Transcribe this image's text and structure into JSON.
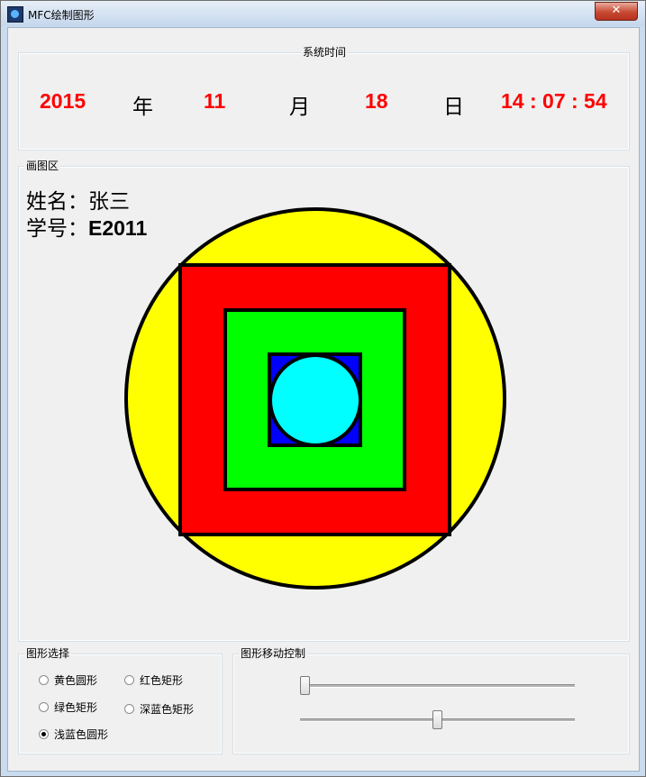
{
  "window": {
    "title": "MFC绘制图形",
    "close_label": "✕"
  },
  "time_group": {
    "title": "系统时间",
    "year": "2015",
    "year_unit": "年",
    "month": "11",
    "month_unit": "月",
    "day": "18",
    "day_unit": "日",
    "time": "14 : 07 : 54"
  },
  "draw_group": {
    "title": "画图区",
    "name_label": "姓名：",
    "name_value": "张三",
    "id_label": "学号：",
    "id_value": "E2011",
    "shapes": [
      {
        "name": "黄色圆形",
        "color": "#ffff00"
      },
      {
        "name": "红色矩形",
        "color": "#ff0000"
      },
      {
        "name": "绿色矩形",
        "color": "#00ff00"
      },
      {
        "name": "深蓝色矩形",
        "color": "#0000ff"
      },
      {
        "name": "浅蓝色圆形",
        "color": "#00ffff"
      }
    ]
  },
  "shape_select": {
    "title": "图形选择",
    "options": [
      "黄色圆形",
      "红色矩形",
      "绿色矩形",
      "深蓝色矩形",
      "浅蓝色圆形"
    ],
    "selected": "浅蓝色圆形"
  },
  "move_control": {
    "title": "图形移动控制",
    "horizontal_slider_fraction": 0.0,
    "vertical_slider_fraction": 0.5
  },
  "colors": {
    "accent_text": "#ff0000"
  }
}
